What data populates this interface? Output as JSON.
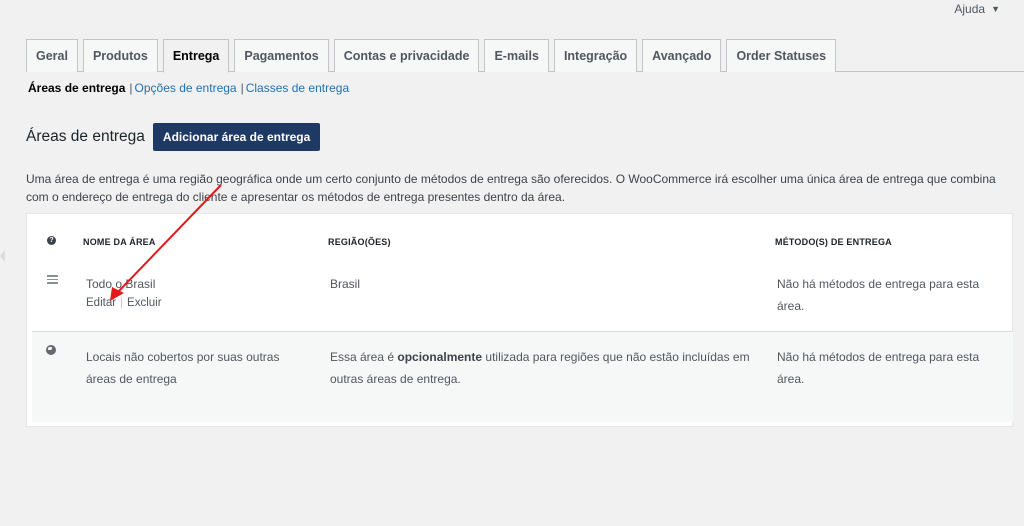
{
  "help": {
    "label": "Ajuda"
  },
  "tabs": [
    {
      "label": "Geral"
    },
    {
      "label": "Produtos"
    },
    {
      "label": "Entrega"
    },
    {
      "label": "Pagamentos"
    },
    {
      "label": "Contas e privacidade"
    },
    {
      "label": "E-mails"
    },
    {
      "label": "Integração"
    },
    {
      "label": "Avançado"
    },
    {
      "label": "Order Statuses"
    }
  ],
  "subnav": {
    "current": "Áreas de entrega",
    "links": [
      "Opções de entrega",
      "Classes de entrega"
    ]
  },
  "page": {
    "title": "Áreas de entrega",
    "add_button": "Adicionar área de entrega",
    "description": "Uma área de entrega é uma região geográfica onde um certo conjunto de métodos de entrega são oferecidos. O WooCommerce irá escolher uma única área de entrega que combina com o endereço de entrega do cliente e apresentar os métodos de entrega presentes dentro da área."
  },
  "table": {
    "headers": {
      "help": "?",
      "name": "NOME DA ÁREA",
      "region": "REGIÃO(ÕES)",
      "methods": "MÉTODO(S) DE ENTREGA"
    },
    "zones": [
      {
        "name": "Todo o Brasil",
        "region": "Brasil",
        "methods": "Não há métodos de entrega para esta área.",
        "actions": {
          "edit": "Editar",
          "delete": "Excluir"
        }
      }
    ],
    "other_zone": {
      "name": "Locais não cobertos por suas outras áreas de entrega",
      "region_pre": "Essa área é ",
      "region_bold": "opcionalmente",
      "region_post": " utilizada para regiões que não estão incluídas em outras áreas de entrega.",
      "methods": "Não há métodos de entrega para esta área."
    }
  },
  "colors": {
    "accent_button": "#1e3a64",
    "link": "#2271b1",
    "annotation_arrow": "#e3191c"
  },
  "icons": [
    "caret-down-icon",
    "help-icon",
    "drag-handle-icon",
    "globe-icon",
    "annotation-arrow"
  ]
}
